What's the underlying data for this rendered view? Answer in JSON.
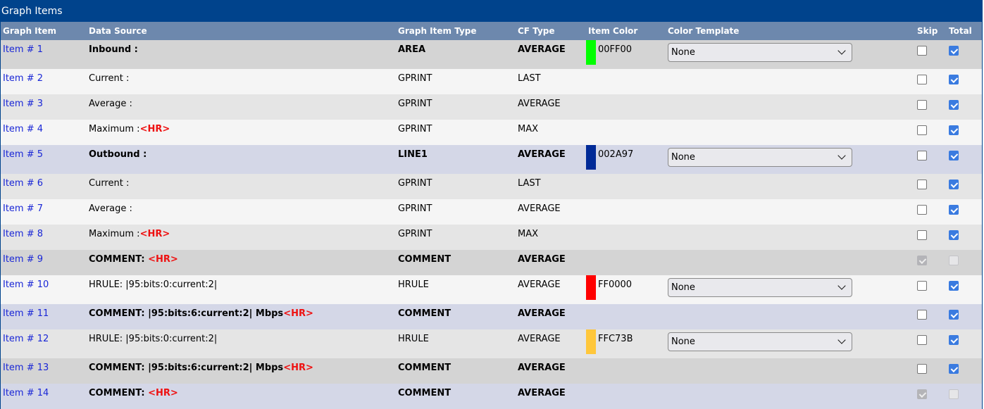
{
  "panel": {
    "title": "Graph Items"
  },
  "columns": [
    "Graph Item",
    "Data Source",
    "Graph Item Type",
    "CF Type",
    "Item Color",
    "Color Template",
    "Skip",
    "Total"
  ],
  "rows": [
    {
      "item": "Item # 1",
      "source": "Inbound :",
      "hr": "",
      "type": "AREA",
      "cf": "AVERAGE",
      "color": "00FF00",
      "swatch": "#00ff00",
      "template": "None",
      "skip": false,
      "total": true,
      "disabled": false,
      "style": "dark",
      "bold": true
    },
    {
      "item": "Item # 2",
      "source": "Current :",
      "hr": "",
      "type": "GPRINT",
      "cf": "LAST",
      "color": "",
      "swatch": "",
      "template": "",
      "skip": false,
      "total": true,
      "disabled": false,
      "style": "light",
      "bold": false
    },
    {
      "item": "Item # 3",
      "source": "Average :",
      "hr": "",
      "type": "GPRINT",
      "cf": "AVERAGE",
      "color": "",
      "swatch": "",
      "template": "",
      "skip": false,
      "total": true,
      "disabled": false,
      "style": "mid",
      "bold": false
    },
    {
      "item": "Item # 4",
      "source": "Maximum :",
      "hr": "<HR>",
      "type": "GPRINT",
      "cf": "MAX",
      "color": "",
      "swatch": "",
      "template": "",
      "skip": false,
      "total": true,
      "disabled": false,
      "style": "light",
      "bold": false
    },
    {
      "item": "Item # 5",
      "source": "Outbound :",
      "hr": "",
      "type": "LINE1",
      "cf": "AVERAGE",
      "color": "002A97",
      "swatch": "#002a97",
      "template": "None",
      "skip": false,
      "total": true,
      "disabled": false,
      "style": "lav",
      "bold": true
    },
    {
      "item": "Item # 6",
      "source": "Current :",
      "hr": "",
      "type": "GPRINT",
      "cf": "LAST",
      "color": "",
      "swatch": "",
      "template": "",
      "skip": false,
      "total": true,
      "disabled": false,
      "style": "mid",
      "bold": false
    },
    {
      "item": "Item # 7",
      "source": "Average :",
      "hr": "",
      "type": "GPRINT",
      "cf": "AVERAGE",
      "color": "",
      "swatch": "",
      "template": "",
      "skip": false,
      "total": true,
      "disabled": false,
      "style": "light",
      "bold": false
    },
    {
      "item": "Item # 8",
      "source": "Maximum :",
      "hr": "<HR>",
      "type": "GPRINT",
      "cf": "MAX",
      "color": "",
      "swatch": "",
      "template": "",
      "skip": false,
      "total": true,
      "disabled": false,
      "style": "mid",
      "bold": false
    },
    {
      "item": "Item # 9",
      "source": "COMMENT: ",
      "hr": "<HR>",
      "type": "COMMENT",
      "cf": "AVERAGE",
      "color": "",
      "swatch": "",
      "template": "",
      "skip": true,
      "total": false,
      "disabled": true,
      "style": "dark",
      "bold": true
    },
    {
      "item": "Item # 10",
      "source": "HRULE: |95:bits:0:current:2|",
      "hr": "",
      "type": "HRULE",
      "cf": "AVERAGE",
      "color": "FF0000",
      "swatch": "#ff0000",
      "template": "None",
      "skip": false,
      "total": true,
      "disabled": false,
      "style": "light",
      "bold": false
    },
    {
      "item": "Item # 11",
      "source": "COMMENT: |95:bits:6:current:2| Mbps",
      "hr": "<HR>",
      "type": "COMMENT",
      "cf": "AVERAGE",
      "color": "",
      "swatch": "",
      "template": "",
      "skip": false,
      "total": true,
      "disabled": false,
      "style": "lav",
      "bold": true
    },
    {
      "item": "Item # 12",
      "source": "HRULE: |95:bits:0:current:2|",
      "hr": "",
      "type": "HRULE",
      "cf": "AVERAGE",
      "color": "FFC73B",
      "swatch": "#ffc73b",
      "template": "None",
      "skip": false,
      "total": true,
      "disabled": false,
      "style": "mid",
      "bold": false
    },
    {
      "item": "Item # 13",
      "source": "COMMENT: |95:bits:6:current:2| Mbps",
      "hr": "<HR>",
      "type": "COMMENT",
      "cf": "AVERAGE",
      "color": "",
      "swatch": "",
      "template": "",
      "skip": false,
      "total": true,
      "disabled": false,
      "style": "dark",
      "bold": true
    },
    {
      "item": "Item # 14",
      "source": "COMMENT: ",
      "hr": "<HR>",
      "type": "COMMENT",
      "cf": "AVERAGE",
      "color": "",
      "swatch": "",
      "template": "",
      "skip": true,
      "total": false,
      "disabled": true,
      "style": "lav",
      "bold": true
    }
  ]
}
